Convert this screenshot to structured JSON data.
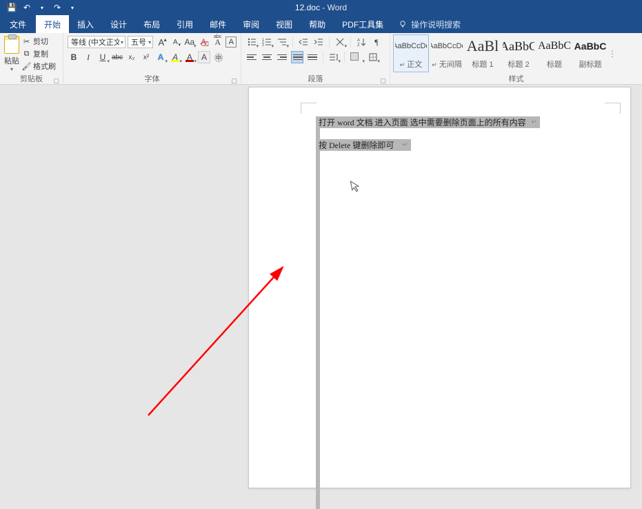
{
  "title": {
    "doc": "12.doc",
    "app": "Word",
    "sep": "  -  "
  },
  "qat": {
    "save": "💾",
    "undo": "↶",
    "redo": "↷",
    "more": "▾"
  },
  "tabs": {
    "file": "文件",
    "home": "开始",
    "insert": "插入",
    "design": "设计",
    "layout": "布局",
    "references": "引用",
    "mailings": "邮件",
    "review": "审阅",
    "view": "视图",
    "help": "帮助",
    "pdf": "PDF工具集",
    "tellme": "操作说明搜索"
  },
  "clipboard": {
    "paste": "粘贴",
    "cut": "剪切",
    "copy": "复制",
    "fmt": "格式刷",
    "group": "剪贴板"
  },
  "font": {
    "name": "等线 (中文正文)",
    "size": "五号",
    "grow": "A",
    "shrink": "A",
    "case": "Aa",
    "clear": "A",
    "phonetic": "A",
    "charborder": "A",
    "bold": "B",
    "italic": "I",
    "underline": "U",
    "strike": "abc",
    "sub": "x₂",
    "sup": "x²",
    "effects": "A",
    "highlight": "A",
    "color": "A",
    "charshade": "A",
    "enclose": "㊥",
    "group": "字体"
  },
  "para": {
    "bullets": "•",
    "numbering": "1",
    "multilevel": "≡",
    "dec": "≤",
    "inc": "≥",
    "asian": "✕",
    "sort": "A↓",
    "marks": "¶",
    "align_l": "L",
    "align_c": "C",
    "align_r": "R",
    "align_j": "J",
    "align_d": "D",
    "spacing": "↕",
    "shading": "■",
    "borders": "▦",
    "group": "段落"
  },
  "styles": {
    "preview_small": "AaBbCcDc",
    "preview_big": "AaBl",
    "preview_h": "AaBbC",
    "preview_sub": "AaBbC",
    "normal": "正文",
    "nospace": "无间隔",
    "h1": "标题 1",
    "h2": "标题 2",
    "title": "标题",
    "subtitle": "副标题",
    "group": "样式"
  },
  "document": {
    "line1": "打开 word 文档   进入页面   选中需要删除页面上的所有内容",
    "line2": "按 Delete 键删除即可",
    "return_mark": "↵"
  }
}
